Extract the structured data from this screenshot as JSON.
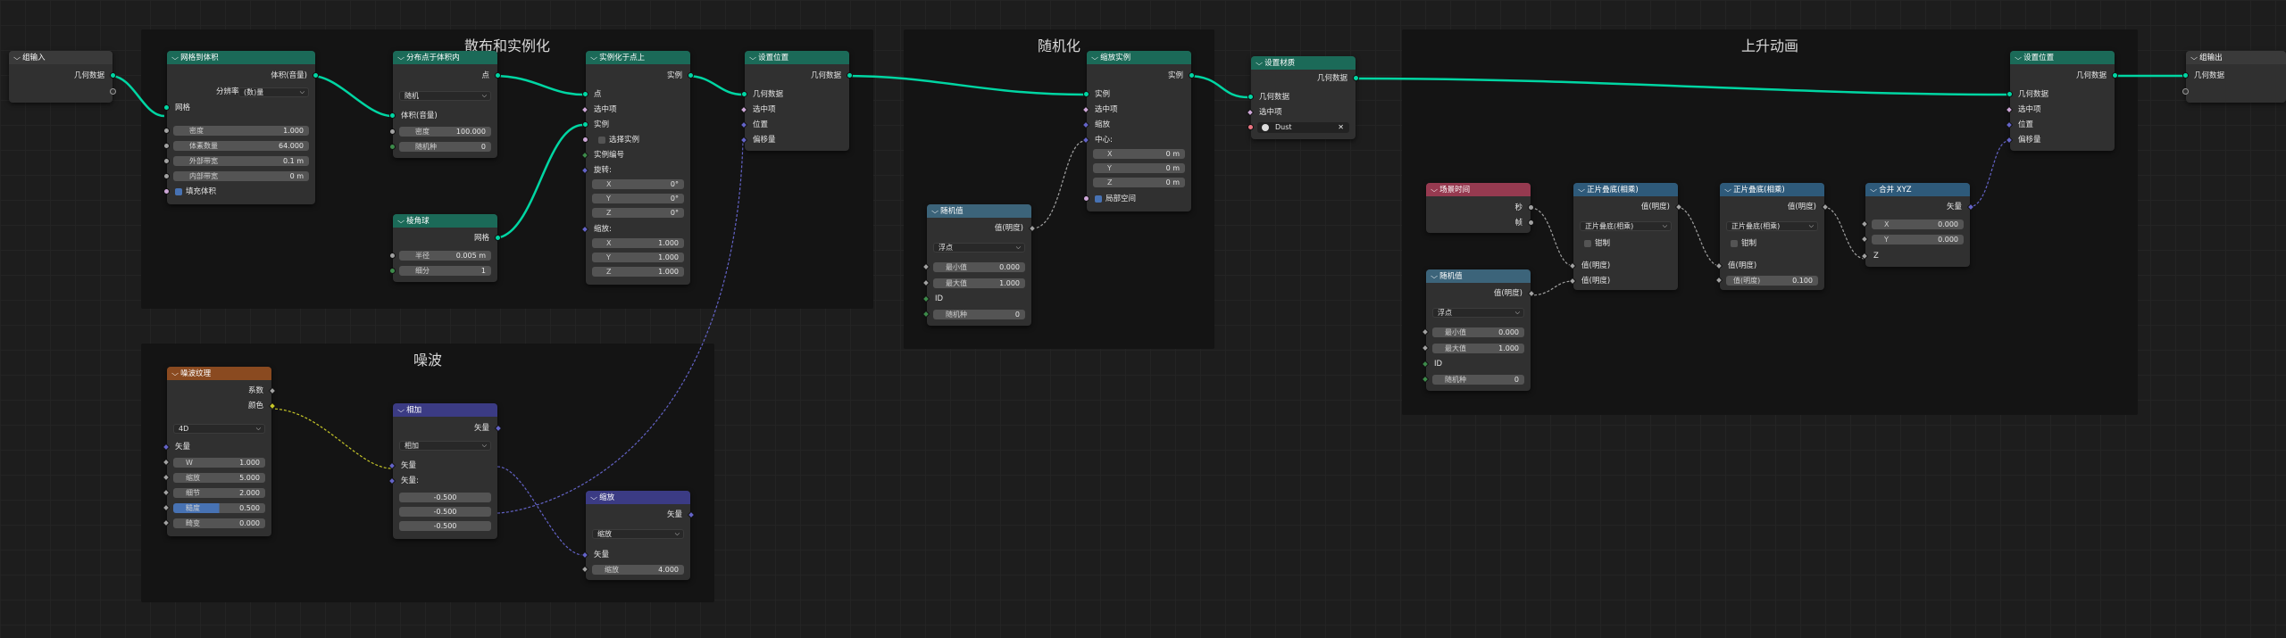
{
  "frames": {
    "scatter": "散布和实例化",
    "noise": "噪波",
    "random": "随机化",
    "rise": "上升动画"
  },
  "group_input": {
    "title": "组输入",
    "geometry": "几何数据"
  },
  "group_output": {
    "title": "组输出",
    "geometry": "几何数据"
  },
  "mesh_to_volume": {
    "title": "网格到体积",
    "out": "体积(音量)",
    "res_label": "分辨率",
    "res_value": "(数)量",
    "mesh": "网格",
    "density_l": "密度",
    "density_v": "1.000",
    "voxel_l": "体素数量",
    "voxel_v": "64.000",
    "ext_l": "外部带宽",
    "ext_v": "0.1 m",
    "int_l": "内部带宽",
    "int_v": "0 m",
    "fill": "填充体积"
  },
  "dist_volume": {
    "title": "分布点于体积内",
    "out": "点",
    "mode": "随机",
    "vol": "体积(音量)",
    "density_l": "密度",
    "density_v": "100.000",
    "seed_l": "随机种",
    "seed_v": "0"
  },
  "ico": {
    "title": "棱角球",
    "out": "网格",
    "radius_l": "半径",
    "radius_v": "0.005 m",
    "sub_l": "细分",
    "sub_v": "1"
  },
  "instance": {
    "title": "实例化于点上",
    "out": "实例",
    "points": "点",
    "selection": "选中项",
    "instance": "实例",
    "pick": "选择实例",
    "index": "实例编号",
    "rotation": "旋转:",
    "rx": "0°",
    "ry": "0°",
    "rz": "0°",
    "scale": "缩放:",
    "sx": "1.000",
    "sy": "1.000",
    "sz": "1.000",
    "X": "X",
    "Y": "Y",
    "Z": "Z"
  },
  "setpos1": {
    "title": "设置位置",
    "out": "几何数据",
    "geo": "几何数据",
    "sel": "选中项",
    "pos": "位置",
    "off": "偏移量"
  },
  "noise_tex": {
    "title": "噪波纹理",
    "fac": "系数",
    "color": "颜色",
    "dim": "4D",
    "vec": "矢量",
    "w_l": "W",
    "w_v": "1.000",
    "scale_l": "缩放",
    "scale_v": "5.000",
    "detail_l": "细节",
    "detail_v": "2.000",
    "rough_l": "糙度",
    "rough_v": "0.500",
    "dist_l": "畸变",
    "dist_v": "0.000"
  },
  "vadd": {
    "title": "相加",
    "out": "矢量",
    "op": "相加",
    "v1": "矢量",
    "v2": "矢量:",
    "a": "-0.500",
    "b": "-0.500",
    "c": "-0.500"
  },
  "vscale": {
    "title": "缩放",
    "out": "矢量",
    "op": "缩放",
    "vec": "矢量",
    "s_l": "缩放",
    "s_v": "4.000"
  },
  "random1": {
    "title": "随机值",
    "out": "值(明度)",
    "type": "浮点",
    "min_l": "最小值",
    "min_v": "0.000",
    "max_l": "最大值",
    "max_v": "1.000",
    "id": "ID",
    "seed_l": "随机种",
    "seed_v": "0"
  },
  "scale_inst": {
    "title": "缩放实例",
    "out": "实例",
    "inst": "实例",
    "sel": "选中项",
    "scale": "缩放",
    "center": "中心:",
    "x_v": "0 m",
    "y_v": "0 m",
    "z_v": "0 m",
    "local": "局部空间"
  },
  "set_mat": {
    "title": "设置材质",
    "out": "几何数据",
    "geo": "几何数据",
    "sel": "选中项",
    "mat": "Dust"
  },
  "scene_time": {
    "title": "场景时间",
    "sec": "秒",
    "frame": "帧"
  },
  "random2": {
    "title": "随机值",
    "out": "值(明度)",
    "type": "浮点",
    "min_l": "最小值",
    "min_v": "0.000",
    "max_l": "最大值",
    "max_v": "1.000",
    "id": "ID",
    "seed_l": "随机种",
    "seed_v": "0"
  },
  "sin1": {
    "title": "正片叠底(相乘)",
    "out": "值(明度)",
    "op": "正片叠底(相乘)",
    "clamp": "钳制",
    "v1": "值(明度)",
    "v2": "值(明度)"
  },
  "sin2": {
    "title": "正片叠底(相乘)",
    "out": "值(明度)",
    "op": "正片叠底(相乘)",
    "clamp": "钳制",
    "v1": "值(明度)",
    "v2_l": "值(明度)",
    "v2_v": "0.100"
  },
  "combine": {
    "title": "合并 XYZ",
    "out": "矢量",
    "x_l": "X",
    "x_v": "0.000",
    "y_l": "Y",
    "y_v": "0.000",
    "z": "Z"
  },
  "setpos2": {
    "title": "设置位置",
    "out": "几何数据",
    "geo": "几何数据",
    "sel": "选中项",
    "pos": "位置",
    "off": "偏移量"
  }
}
